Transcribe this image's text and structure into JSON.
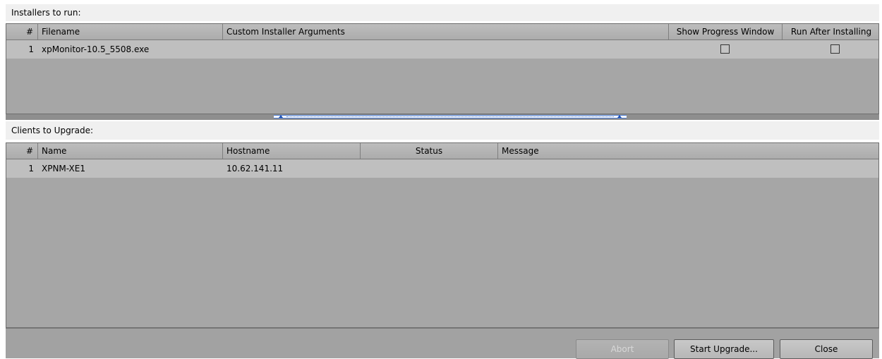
{
  "installers": {
    "label": "Installers to run:",
    "columns": [
      "#",
      "Filename",
      "Custom Installer Arguments",
      "Show Progress Window",
      "Run After Installing"
    ],
    "rows": [
      {
        "num": "1",
        "filename": "xpMonitor-10.5_5508.exe",
        "args": "",
        "show_progress": false,
        "run_after": false
      }
    ]
  },
  "clients": {
    "label": "Clients to Upgrade:",
    "columns": [
      "#",
      "Name",
      "Hostname",
      "Status",
      "Message"
    ],
    "rows": [
      {
        "num": "1",
        "name": "XPNM-XE1",
        "hostname": "10.62.141.11",
        "status": "",
        "message": ""
      }
    ]
  },
  "buttons": {
    "abort": "Abort",
    "start": "Start Upgrade...",
    "close": "Close"
  },
  "colors": {
    "table_bg": "#a6a6a6",
    "row_bg": "#bfbfbf",
    "splitter_accent": "#1d4fb3"
  }
}
